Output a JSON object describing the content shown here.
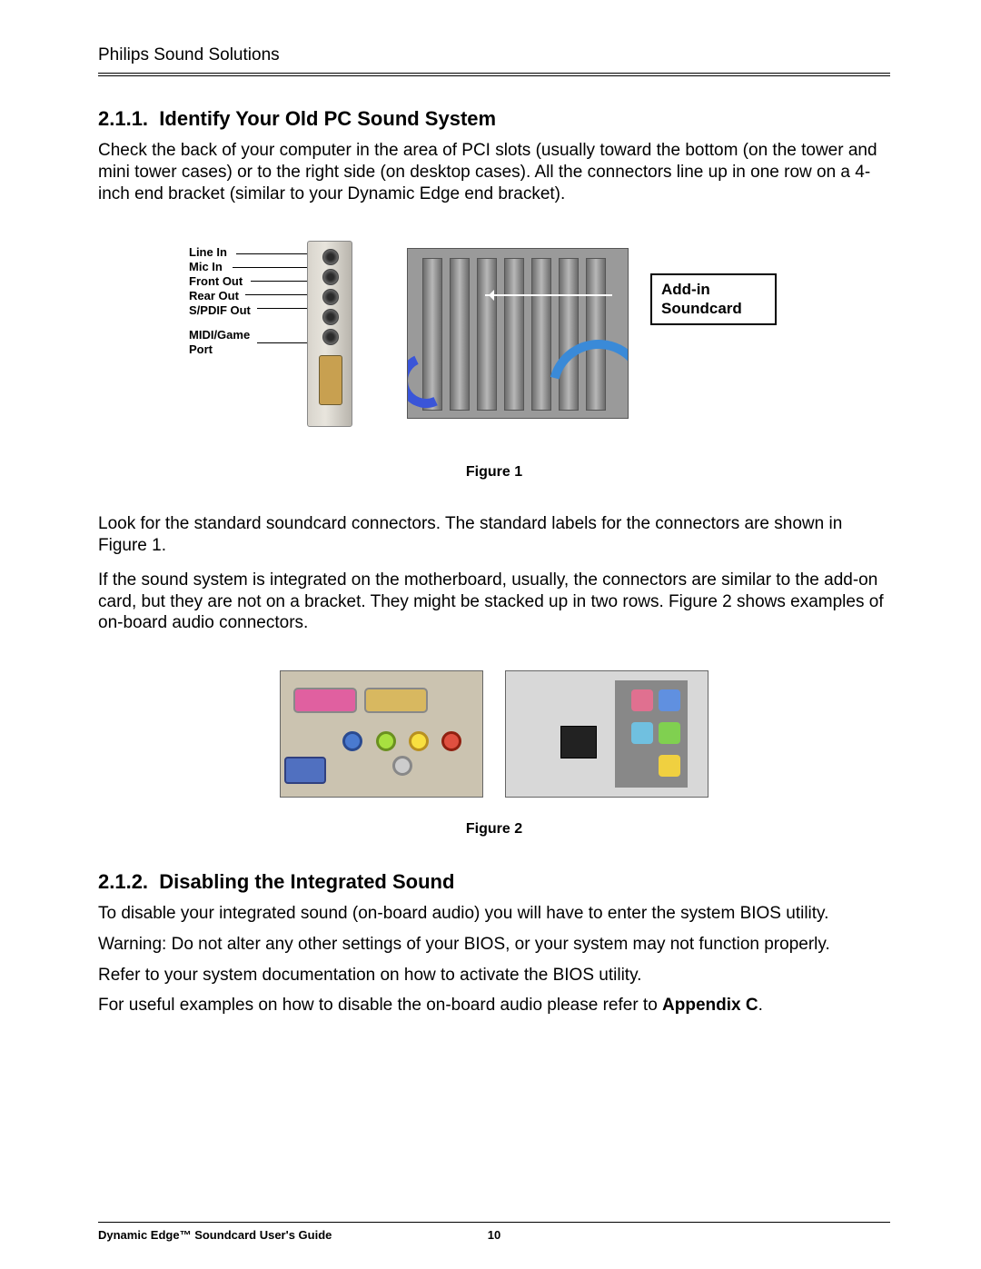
{
  "header": "Philips Sound Solutions",
  "section_211": {
    "number": "2.1.1.",
    "title": "Identify Your Old PC Sound System",
    "p1": "Check the back of your computer in the area of PCI slots (usually toward the bottom (on the tower and mini tower cases) or to the right side (on desktop cases). All the connectors line up in one row on a 4-inch end bracket (similar to your Dynamic Edge end bracket)."
  },
  "bracket_labels": {
    "line_in": "Line In",
    "mic_in": "Mic In",
    "front_out": "Front Out",
    "rear_out": "Rear Out",
    "spdif_out": "S/PDIF Out",
    "midi_game": "MIDI/Game",
    "port": "Port"
  },
  "callout": {
    "line1": "Add-in",
    "line2": "Soundcard"
  },
  "figure1_caption": "Figure 1",
  "mid_paragraphs": {
    "p2": "Look for the standard soundcard connectors. The standard labels for the connectors are shown in Figure 1.",
    "p3": "If the sound system is integrated on the motherboard, usually, the connectors are similar to the add-on card, but they are not on a bracket. They might be stacked up in two rows. Figure 2 shows examples of on-board audio connectors."
  },
  "figure2_caption": "Figure 2",
  "section_212": {
    "number": "2.1.2.",
    "title": "Disabling the Integrated Sound",
    "p1": "To disable your integrated sound (on-board audio) you will have to enter the system BIOS utility.",
    "p2": "Warning: Do not alter any other settings of your BIOS, or your system may not function properly.",
    "p3": "Refer to your system documentation on how to activate the BIOS utility.",
    "p4_a": "For useful examples on how to disable the on-board audio please refer to ",
    "p4_b": "Appendix C",
    "p4_c": "."
  },
  "footer": {
    "title": "Dynamic Edge™ Soundcard User's Guide",
    "page": "10"
  }
}
